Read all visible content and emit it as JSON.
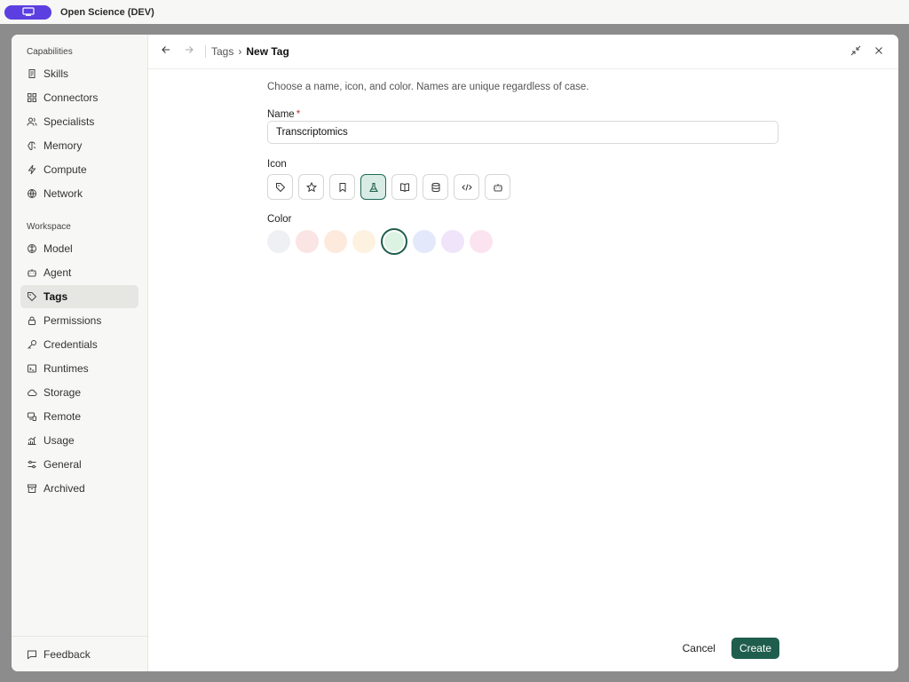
{
  "app": {
    "title": "Open Science (DEV)",
    "pill_color": "#5b3fe0"
  },
  "sidebar": {
    "sections": [
      {
        "label": "Capabilities",
        "items": [
          {
            "label": "Skills",
            "icon": "scroll-icon"
          },
          {
            "label": "Connectors",
            "icon": "grid-icon"
          },
          {
            "label": "Specialists",
            "icon": "users-icon"
          },
          {
            "label": "Memory",
            "icon": "brain-icon"
          },
          {
            "label": "Compute",
            "icon": "lightning-icon"
          },
          {
            "label": "Network",
            "icon": "globe-icon"
          }
        ]
      },
      {
        "label": "Workspace",
        "items": [
          {
            "label": "Model",
            "icon": "model-icon"
          },
          {
            "label": "Agent",
            "icon": "robot-icon"
          },
          {
            "label": "Tags",
            "icon": "tags-icon",
            "active": true
          },
          {
            "label": "Permissions",
            "icon": "lock-icon"
          },
          {
            "label": "Credentials",
            "icon": "key-icon"
          },
          {
            "label": "Runtimes",
            "icon": "terminal-icon"
          },
          {
            "label": "Storage",
            "icon": "cloud-icon"
          },
          {
            "label": "Remote",
            "icon": "remote-icon"
          },
          {
            "label": "Usage",
            "icon": "chart-icon"
          },
          {
            "label": "General",
            "icon": "sliders-icon"
          },
          {
            "label": "Archived",
            "icon": "archive-icon"
          }
        ]
      }
    ],
    "footer": {
      "label": "Feedback",
      "icon": "message-icon"
    }
  },
  "header": {
    "breadcrumb_parent": "Tags",
    "breadcrumb_sep": "›",
    "breadcrumb_current": "New Tag"
  },
  "form": {
    "hint": "Choose a name, icon, and color. Names are unique regardless of case.",
    "name_label": "Name",
    "required_mark": "*",
    "name_value": "Transcriptomics",
    "icon_label": "Icon",
    "icons": [
      "tag-icon",
      "star-icon",
      "bookmark-icon",
      "flask-icon",
      "book-icon",
      "database-icon",
      "code-icon",
      "robot-icon"
    ],
    "selected_icon": "flask-icon",
    "color_label": "Color",
    "colors": [
      "#eef0f4",
      "#fbe4e4",
      "#fdeadc",
      "#fdf1df",
      "#dcf2e2",
      "#e4e8fb",
      "#efe4fa",
      "#fbe4ef"
    ],
    "selected_color": "#dcf2e2"
  },
  "actions": {
    "cancel": "Cancel",
    "create": "Create"
  },
  "colors": {
    "accent": "#1f5e4c",
    "accent_selected_bg": "#d8ece5"
  }
}
